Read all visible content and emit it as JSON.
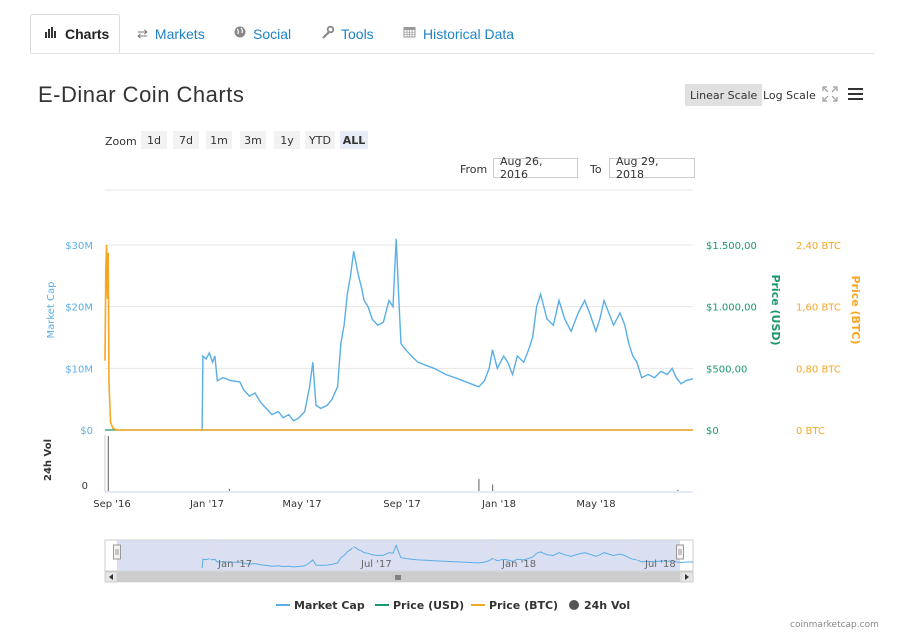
{
  "tabs": [
    {
      "label": "Charts",
      "icon": "bar-chart-icon",
      "active": true
    },
    {
      "label": "Markets",
      "icon": "exchange-arrows-icon",
      "active": false
    },
    {
      "label": "Social",
      "icon": "globe-icon",
      "active": false
    },
    {
      "label": "Tools",
      "icon": "wrench-icon",
      "active": false
    },
    {
      "label": "Historical Data",
      "icon": "calendar-icon",
      "active": false
    }
  ],
  "page_title": "E-Dinar Coin Charts",
  "scale": {
    "linear_label": "Linear Scale",
    "log_label": "Log Scale",
    "active": "linear"
  },
  "zoom": {
    "label": "Zoom",
    "options": [
      "1d",
      "7d",
      "1m",
      "3m",
      "1y",
      "YTD",
      "ALL"
    ],
    "selected": "ALL"
  },
  "range": {
    "from_label": "From",
    "from_value": "Aug 26, 2016",
    "to_label": "To",
    "to_value": "Aug 29, 2018"
  },
  "credit": "coinmarketcap.com",
  "colors": {
    "market_cap": "#5aaee6",
    "price_usd": "#1a9868",
    "price_btc": "#f5a623",
    "volume": "#777777",
    "tab_link": "#1e82c7"
  },
  "chart_data": {
    "type": "line",
    "title": "E-Dinar Coin Charts",
    "x_tick_labels": [
      "Sep '16",
      "Jan '17",
      "May '17",
      "Sep '17",
      "Jan '18",
      "May '18"
    ],
    "y_axes": [
      {
        "name": "Market Cap",
        "tick_labels": [
          "$0",
          "$10M",
          "$20M",
          "$30M"
        ],
        "range": [
          0,
          30000000
        ],
        "color": "#5aaee6"
      },
      {
        "name": "Price (USD)",
        "tick_labels": [
          "$0",
          "$500,00",
          "$1.000,00",
          "$1.500,00"
        ],
        "range": [
          0,
          1500
        ],
        "color": "#1a9868"
      },
      {
        "name": "Price (BTC)",
        "tick_labels": [
          "0 BTC",
          "0,80 BTC",
          "1,60 BTC",
          "2,40 BTC"
        ],
        "range": [
          0,
          2.4
        ],
        "color": "#f5a623"
      },
      {
        "name": "24h Vol",
        "tick_labels": [
          "0"
        ]
      }
    ],
    "series": [
      {
        "name": "Market Cap",
        "color": "#5aaee6",
        "points": [
          [
            "2016-12-25",
            0
          ],
          [
            "2016-12-26",
            12000000
          ],
          [
            "2016-12-30",
            11500000
          ],
          [
            "2017-01-03",
            12500000
          ],
          [
            "2017-01-07",
            11000000
          ],
          [
            "2017-01-10",
            12000000
          ],
          [
            "2017-01-13",
            8000000
          ],
          [
            "2017-01-20",
            8500000
          ],
          [
            "2017-01-30",
            8000000
          ],
          [
            "2017-02-10",
            7800000
          ],
          [
            "2017-02-15",
            6500000
          ],
          [
            "2017-02-22",
            5500000
          ],
          [
            "2017-03-01",
            6000000
          ],
          [
            "2017-03-08",
            4500000
          ],
          [
            "2017-03-15",
            3500000
          ],
          [
            "2017-03-22",
            2500000
          ],
          [
            "2017-03-30",
            3000000
          ],
          [
            "2017-04-05",
            2000000
          ],
          [
            "2017-04-12",
            2500000
          ],
          [
            "2017-04-18",
            1500000
          ],
          [
            "2017-04-25",
            2000000
          ],
          [
            "2017-05-02",
            3000000
          ],
          [
            "2017-05-08",
            7000000
          ],
          [
            "2017-05-12",
            11000000
          ],
          [
            "2017-05-16",
            4000000
          ],
          [
            "2017-05-22",
            3500000
          ],
          [
            "2017-05-30",
            4000000
          ],
          [
            "2017-06-05",
            5000000
          ],
          [
            "2017-06-12",
            7000000
          ],
          [
            "2017-06-16",
            14000000
          ],
          [
            "2017-06-20",
            17000000
          ],
          [
            "2017-06-24",
            22000000
          ],
          [
            "2017-06-28",
            25000000
          ],
          [
            "2017-07-02",
            29000000
          ],
          [
            "2017-07-05",
            27000000
          ],
          [
            "2017-07-08",
            25000000
          ],
          [
            "2017-07-12",
            23000000
          ],
          [
            "2017-07-15",
            21000000
          ],
          [
            "2017-07-20",
            20000000
          ],
          [
            "2017-07-25",
            18000000
          ],
          [
            "2017-08-01",
            17000000
          ],
          [
            "2017-08-08",
            17500000
          ],
          [
            "2017-08-15",
            21000000
          ],
          [
            "2017-08-20",
            20000000
          ],
          [
            "2017-08-24",
            31000000
          ],
          [
            "2017-08-27",
            22000000
          ],
          [
            "2017-08-30",
            14000000
          ],
          [
            "2017-09-05",
            13000000
          ],
          [
            "2017-09-12",
            12000000
          ],
          [
            "2017-09-20",
            11000000
          ],
          [
            "2017-09-30",
            10500000
          ],
          [
            "2017-10-10",
            10000000
          ],
          [
            "2017-10-25",
            9000000
          ],
          [
            "2017-11-05",
            8500000
          ],
          [
            "2017-11-15",
            8000000
          ],
          [
            "2017-11-25",
            7500000
          ],
          [
            "2017-12-05",
            7000000
          ],
          [
            "2017-12-12",
            8000000
          ],
          [
            "2017-12-18",
            10000000
          ],
          [
            "2017-12-22",
            13000000
          ],
          [
            "2017-12-28",
            10000000
          ],
          [
            "2018-01-05",
            12000000
          ],
          [
            "2018-01-10",
            11000000
          ],
          [
            "2018-01-16",
            9000000
          ],
          [
            "2018-01-22",
            12000000
          ],
          [
            "2018-01-30",
            11000000
          ],
          [
            "2018-02-05",
            13000000
          ],
          [
            "2018-02-10",
            15000000
          ],
          [
            "2018-02-15",
            20000000
          ],
          [
            "2018-02-20",
            22000000
          ],
          [
            "2018-02-28",
            18000000
          ],
          [
            "2018-03-08",
            17000000
          ],
          [
            "2018-03-15",
            21000000
          ],
          [
            "2018-03-22",
            18000000
          ],
          [
            "2018-03-30",
            16000000
          ],
          [
            "2018-04-08",
            19000000
          ],
          [
            "2018-04-16",
            21000000
          ],
          [
            "2018-04-22",
            19000000
          ],
          [
            "2018-04-30",
            16000000
          ],
          [
            "2018-05-05",
            18000000
          ],
          [
            "2018-05-10",
            21000000
          ],
          [
            "2018-05-16",
            19000000
          ],
          [
            "2018-05-22",
            17000000
          ],
          [
            "2018-05-30",
            19000000
          ],
          [
            "2018-06-05",
            17000000
          ],
          [
            "2018-06-10",
            14000000
          ],
          [
            "2018-06-15",
            12000000
          ],
          [
            "2018-06-20",
            11000000
          ],
          [
            "2018-06-26",
            8500000
          ],
          [
            "2018-07-04",
            9000000
          ],
          [
            "2018-07-12",
            8500000
          ],
          [
            "2018-07-20",
            9500000
          ],
          [
            "2018-07-28",
            9000000
          ],
          [
            "2018-08-03",
            10000000
          ],
          [
            "2018-08-08",
            8500000
          ],
          [
            "2018-08-14",
            7500000
          ],
          [
            "2018-08-20",
            8000000
          ],
          [
            "2018-08-29",
            8300000
          ]
        ]
      },
      {
        "name": "Price (USD)",
        "color": "#1a9868",
        "points": [
          [
            "2016-08-26",
            0
          ],
          [
            "2018-08-29",
            0
          ]
        ]
      },
      {
        "name": "Price (BTC)",
        "color": "#f5a623",
        "points": [
          [
            "2016-08-26",
            0.9
          ],
          [
            "2016-08-27",
            2.1
          ],
          [
            "2016-08-28",
            2.4
          ],
          [
            "2016-08-29",
            1.7
          ],
          [
            "2016-08-30",
            2.3
          ],
          [
            "2016-08-31",
            0.6
          ],
          [
            "2016-09-02",
            0.1
          ],
          [
            "2016-09-05",
            0.02
          ],
          [
            "2016-09-10",
            0
          ],
          [
            "2018-08-29",
            0
          ]
        ]
      },
      {
        "name": "24h Vol",
        "color": "#777777",
        "bars": [
          [
            "2016-08-30",
            1
          ],
          [
            "2017-01-28",
            0.04
          ],
          [
            "2017-12-05",
            0.22
          ],
          [
            "2017-12-22",
            0.12
          ],
          [
            "2018-08-10",
            0.02
          ]
        ]
      }
    ],
    "navigator_tick_labels": [
      "Jan '17",
      "Jul '17",
      "Jan '18",
      "Jul '18"
    ],
    "legend": [
      {
        "name": "Market Cap",
        "color": "#5aaee6",
        "symbol": "line"
      },
      {
        "name": "Price (USD)",
        "color": "#1a9868",
        "symbol": "line"
      },
      {
        "name": "Price (BTC)",
        "color": "#f5a623",
        "symbol": "line"
      },
      {
        "name": "24h Vol",
        "color": "#555555",
        "symbol": "dot"
      }
    ],
    "legend_position": "bottom",
    "grid": true
  }
}
